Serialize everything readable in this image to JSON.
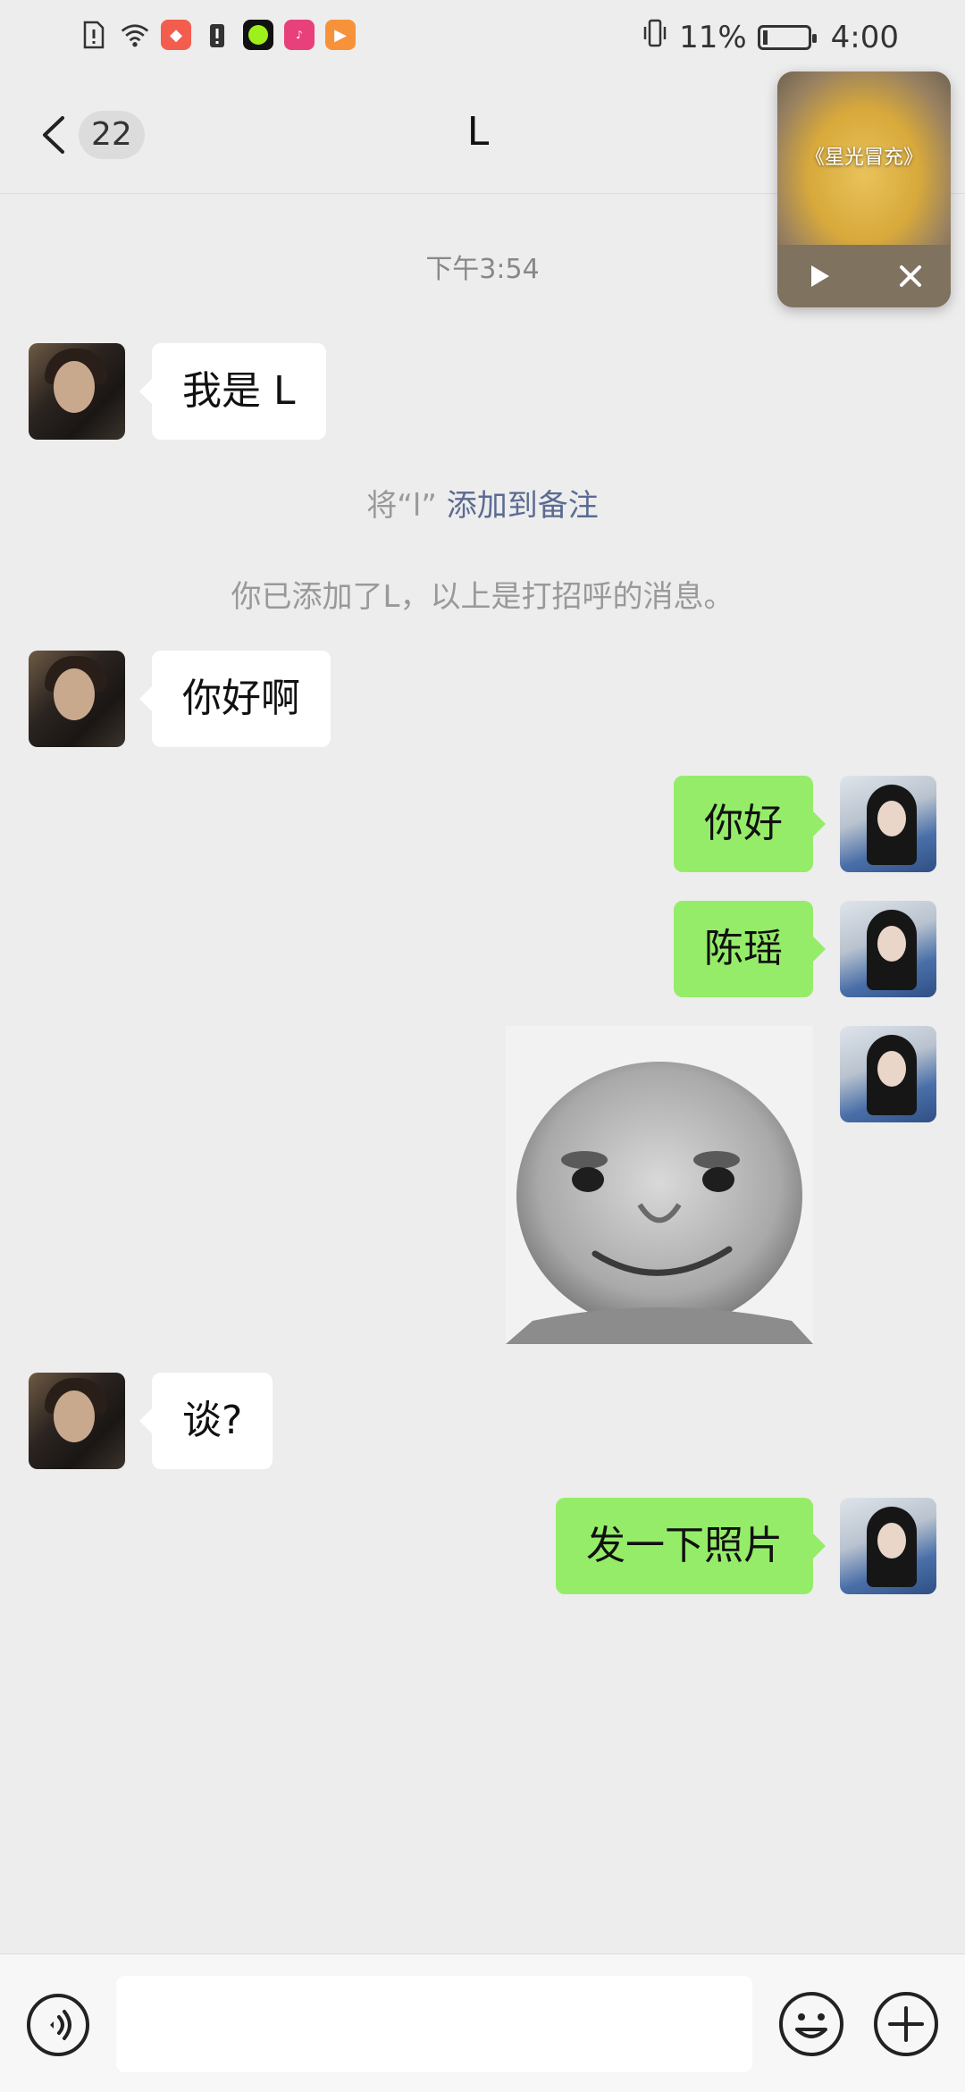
{
  "status_bar": {
    "battery_text": "11%",
    "battery_level": 0.11,
    "time": "4:00",
    "left_icons": [
      "alert-doc-icon",
      "wifi-icon",
      "shopping-app-icon",
      "alert-icon",
      "green-circle-app-icon",
      "video-app-icon",
      "play-app-icon"
    ],
    "right_icons": [
      "vibrate-icon",
      "battery-icon"
    ]
  },
  "header": {
    "back_icon": "chevron-left-icon",
    "unread_count": "22",
    "title": "L"
  },
  "floating_video": {
    "caption": "《星光冒充》",
    "play_icon": "play-icon",
    "close_icon": "close-icon"
  },
  "chat": {
    "timestamp": "下午3:54",
    "messages": [
      {
        "side": "in",
        "type": "text",
        "text": "我是 L"
      },
      {
        "side": "in",
        "type": "text",
        "text": "你好啊"
      },
      {
        "side": "out",
        "type": "text",
        "text": "你好"
      },
      {
        "side": "out",
        "type": "text",
        "text": "陈瑶"
      },
      {
        "side": "out",
        "type": "sticker",
        "description": "smiling baby face"
      },
      {
        "side": "in",
        "type": "text",
        "text": "谈?"
      },
      {
        "side": "out",
        "type": "text",
        "text": "发一下照片"
      }
    ],
    "system_note_prefix": "将“l”",
    "system_note_link": "添加到备注",
    "system_greeting": "你已添加了L，以上是打招呼的消息。"
  },
  "input_bar": {
    "voice_icon": "voice-icon",
    "input_value": "",
    "emoji_icon": "emoji-icon",
    "plus_icon": "plus-icon"
  },
  "colors": {
    "background": "#ededed",
    "outgoing_bubble": "#95ec69",
    "incoming_bubble": "#ffffff",
    "link": "#5b6b91"
  }
}
